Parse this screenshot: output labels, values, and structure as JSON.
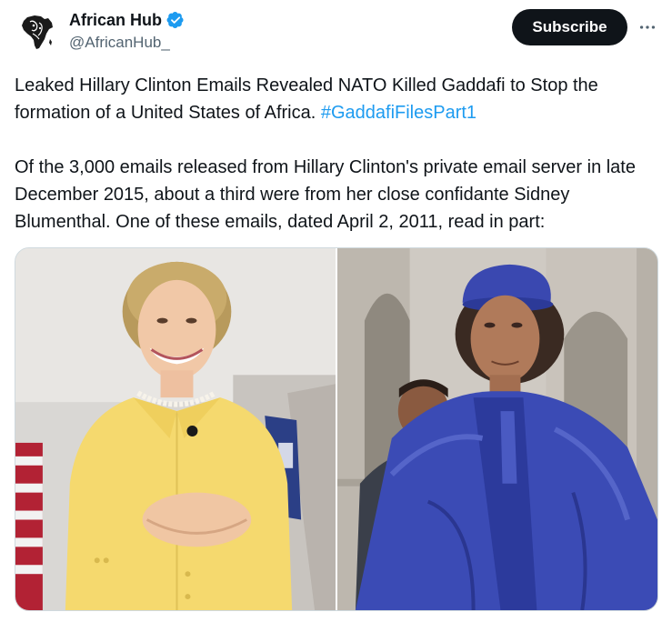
{
  "author": {
    "display_name": "African Hub",
    "handle": "@AfricanHub_",
    "avatar_icon": "africa-map-logo",
    "verified_icon": "verified-badge-icon"
  },
  "actions": {
    "subscribe_label": "Subscribe",
    "more_icon": "more-horizontal-icon"
  },
  "tweet": {
    "paragraph1_text": "Leaked Hillary Clinton Emails Revealed NATO Killed Gaddafi to Stop the formation of a United States of Africa. ",
    "hashtag": "#GaddafiFilesPart1",
    "paragraph2_text": "Of the 3,000 emails released from Hillary Clinton's private email server in late December 2015, about a third were from her close confidante Sidney Blumenthal. One of these emails, dated April 2, 2011, read in part:"
  },
  "media": {
    "photos": [
      {
        "name": "photo-woman-yellow-suit"
      },
      {
        "name": "photo-man-blue-robes"
      }
    ]
  },
  "colors": {
    "text": "#0f1419",
    "secondary_text": "#536471",
    "link": "#1d9bf0",
    "subscribe_bg": "#0f1419",
    "verified": "#1d9bf0"
  }
}
